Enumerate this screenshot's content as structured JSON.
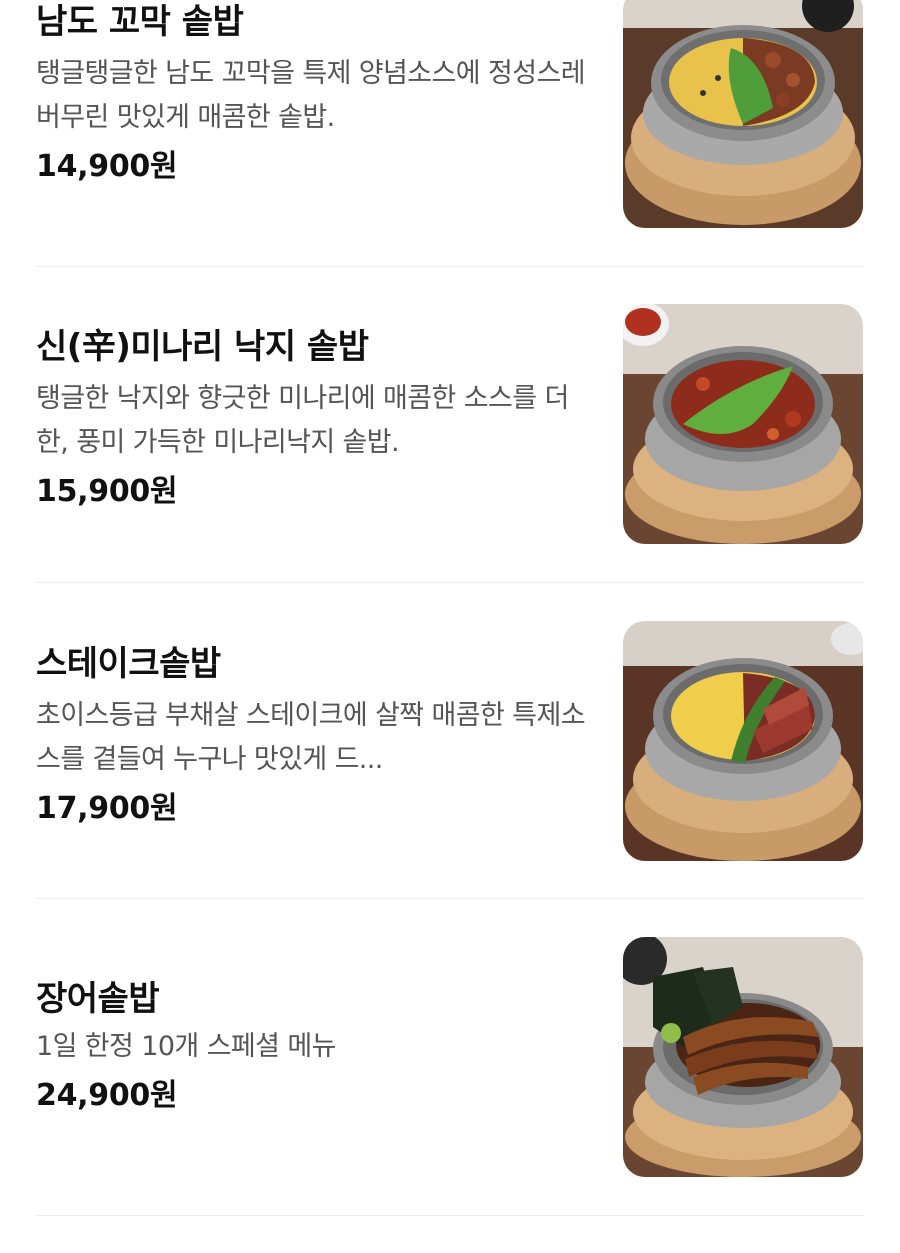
{
  "menu": {
    "items": [
      {
        "name": "남도 꼬막 솥밥",
        "description": "탱글탱글한 남도 꼬막을 특제 양념소스에 정성스레 버무린 맛있게 매콤한 솥밥.",
        "price": "14,900원"
      },
      {
        "name": "신(辛)미나리 낙지 솥밥",
        "description": "탱글한 낙지와 향긋한 미나리에 매콤한 소스를 더한, 풍미 가득한 미나리낙지 솥밥.",
        "price": "15,900원"
      },
      {
        "name": "스테이크솥밥",
        "description": "초이스등급 부채살 스테이크에 살짝 매콤한 특제소스를 곁들여 누구나 맛있게 드...",
        "price": "17,900원"
      },
      {
        "name": "장어솥밥",
        "description": "1일 한정 10개 스페셜 메뉴",
        "price": "24,900원"
      }
    ]
  }
}
